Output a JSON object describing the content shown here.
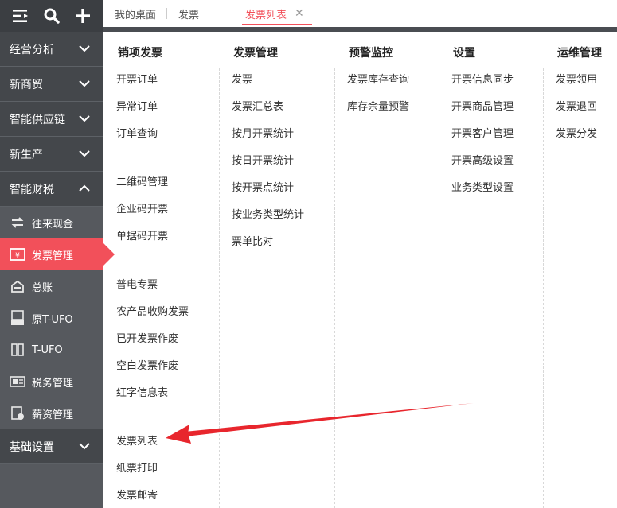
{
  "sidebar": {
    "top_icons": [
      "menu-collapse-icon",
      "search-icon",
      "plus-icon"
    ],
    "groups": [
      {
        "label": "经营分析"
      },
      {
        "label": "新商贸"
      },
      {
        "label": "智能供应链"
      },
      {
        "label": "新生产"
      },
      {
        "label": "智能财税"
      }
    ],
    "sub_items": [
      {
        "label": "往来现金",
        "icon": "cash-exchange-icon"
      },
      {
        "label": "发票管理",
        "icon": "invoice-icon"
      },
      {
        "label": "总账",
        "icon": "ledger-icon"
      },
      {
        "label": "原T-UFO",
        "icon": "ufo-report-icon"
      },
      {
        "label": "T-UFO",
        "icon": "ufo-report-icon"
      },
      {
        "label": "税务管理",
        "icon": "tax-icon"
      },
      {
        "label": "薪资管理",
        "icon": "salary-icon"
      }
    ],
    "bottom_group": {
      "label": "基础设置"
    },
    "accent_color": "#f2505a"
  },
  "tabs": [
    {
      "label": "我的桌面"
    },
    {
      "label": "发票"
    },
    {
      "label": "发票列表"
    }
  ],
  "menu": {
    "col1": {
      "title": "销项发票",
      "items": [
        "开票订单",
        "异常订单",
        "订单查询",
        "二维码管理",
        "企业码开票",
        "单据码开票",
        "普电专票",
        "农产品收购发票",
        "已开发票作废",
        "空白发票作废",
        "红字信息表",
        "发票列表",
        "纸票打印",
        "发票邮寄"
      ]
    },
    "col2": {
      "title": "发票管理",
      "items": [
        "发票",
        "发票汇总表",
        "按月开票统计",
        "按日开票统计",
        "按开票点统计",
        "按业务类型统计",
        "票单比对"
      ]
    },
    "col3": {
      "title": "预警监控",
      "items": [
        "发票库存查询",
        "库存余量预警"
      ]
    },
    "col4": {
      "title": "设置",
      "items": [
        "开票信息同步",
        "开票商品管理",
        "开票客户管理",
        "开票高级设置",
        "业务类型设置"
      ]
    },
    "col5": {
      "title": "运维管理",
      "items": [
        "发票领用",
        "发票退回",
        "发票分发"
      ]
    }
  },
  "annotation": {
    "color": "#e8262d"
  }
}
